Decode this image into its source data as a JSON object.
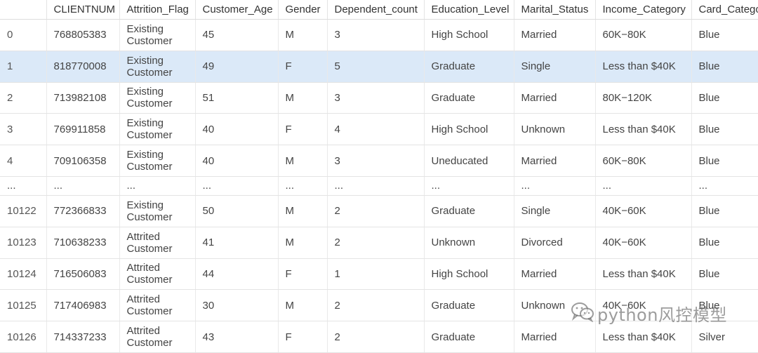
{
  "columns": [
    "",
    "CLIENTNUM",
    "Attrition_Flag",
    "Customer_Age",
    "Gender",
    "Dependent_count",
    "Education_Level",
    "Marital_Status",
    "Income_Category",
    "Card_Catego"
  ],
  "rows": [
    {
      "index": "0",
      "clientnum": "768805383",
      "attrition": "Existing Customer",
      "age": "45",
      "gender": "M",
      "dependents": "3",
      "education": "High School",
      "marital": "Married",
      "income": "60K−80K",
      "card": "Blue",
      "selected": false
    },
    {
      "index": "1",
      "clientnum": "818770008",
      "attrition": "Existing Customer",
      "age": "49",
      "gender": "F",
      "dependents": "5",
      "education": "Graduate",
      "marital": "Single",
      "income": "Less than $40K",
      "card": "Blue",
      "selected": true
    },
    {
      "index": "2",
      "clientnum": "713982108",
      "attrition": "Existing Customer",
      "age": "51",
      "gender": "M",
      "dependents": "3",
      "education": "Graduate",
      "marital": "Married",
      "income": "80K−120K",
      "card": "Blue",
      "selected": false
    },
    {
      "index": "3",
      "clientnum": "769911858",
      "attrition": "Existing Customer",
      "age": "40",
      "gender": "F",
      "dependents": "4",
      "education": "High School",
      "marital": "Unknown",
      "income": "Less than $40K",
      "card": "Blue",
      "selected": false
    },
    {
      "index": "4",
      "clientnum": "709106358",
      "attrition": "Existing Customer",
      "age": "40",
      "gender": "M",
      "dependents": "3",
      "education": "Uneducated",
      "marital": "Married",
      "income": "60K−80K",
      "card": "Blue",
      "selected": false
    },
    {
      "ellipsis": true,
      "text": "..."
    },
    {
      "index": "10122",
      "clientnum": "772366833",
      "attrition": "Existing Customer",
      "age": "50",
      "gender": "M",
      "dependents": "2",
      "education": "Graduate",
      "marital": "Single",
      "income": "40K−60K",
      "card": "Blue",
      "selected": false
    },
    {
      "index": "10123",
      "clientnum": "710638233",
      "attrition": "Attrited Customer",
      "age": "41",
      "gender": "M",
      "dependents": "2",
      "education": "Unknown",
      "marital": "Divorced",
      "income": "40K−60K",
      "card": "Blue",
      "selected": false
    },
    {
      "index": "10124",
      "clientnum": "716506083",
      "attrition": "Attrited Customer",
      "age": "44",
      "gender": "F",
      "dependents": "1",
      "education": "High School",
      "marital": "Married",
      "income": "Less than $40K",
      "card": "Blue",
      "selected": false
    },
    {
      "index": "10125",
      "clientnum": "717406983",
      "attrition": "Attrited Customer",
      "age": "30",
      "gender": "M",
      "dependents": "2",
      "education": "Graduate",
      "marital": "Unknown",
      "income": "40K−60K",
      "card": "Blue",
      "selected": false
    },
    {
      "index": "10126",
      "clientnum": "714337233",
      "attrition": "Attrited Customer",
      "age": "43",
      "gender": "F",
      "dependents": "2",
      "education": "Graduate",
      "marital": "Married",
      "income": "Less than $40K",
      "card": "Silver",
      "selected": false
    }
  ],
  "watermark": {
    "text": "python风控模型",
    "icon": "wechat-icon"
  },
  "colors": {
    "selected_row": "#dbe9f8",
    "grid_line": "#e4e4e4",
    "text": "#444444"
  }
}
